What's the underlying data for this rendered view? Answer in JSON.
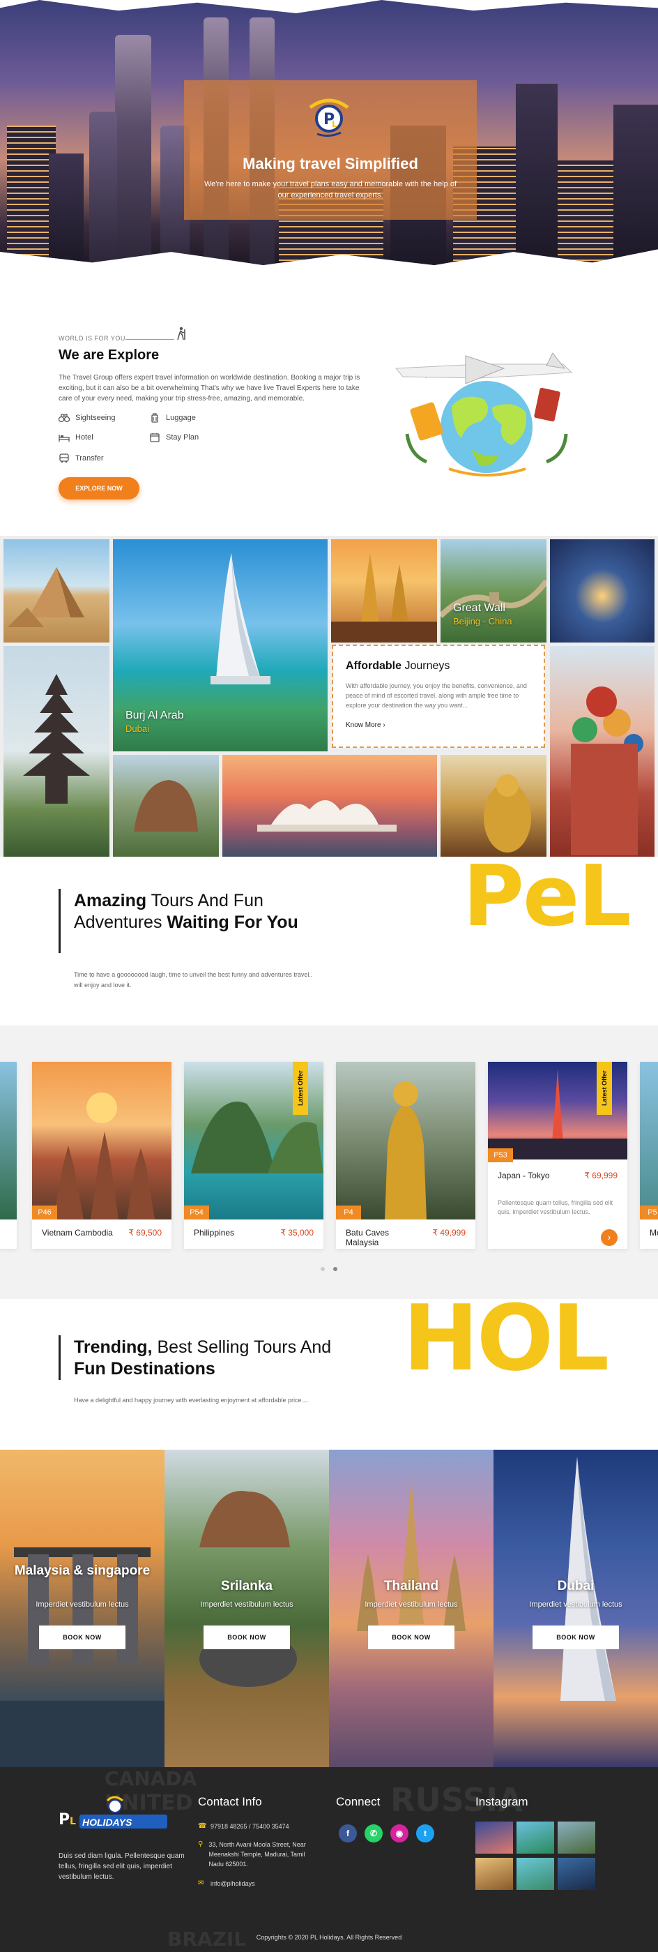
{
  "hero": {
    "title": "Making travel Simplified",
    "subtitle": "We're here to make your travel plans easy and memorable with the help of our experienced travel experts.",
    "slides": 2,
    "active_slide": 1
  },
  "explore": {
    "kicker": "WORLD IS FOR YOU",
    "title": "We are Explore",
    "text": "The Travel Group offers expert travel information on worldwide destination. Booking a major trip is exciting, but it can also be a bit overwhelming That's why we have live Travel Experts here to take care of your every need, making your trip stress-free, amazing, and memorable.",
    "features": [
      "Sightseeing",
      "Luggage",
      "Hotel",
      "Stay Plan",
      "Transfer"
    ],
    "button": "EXPLORE NOW"
  },
  "gallery": {
    "burj_title": "Burj Al Arab",
    "burj_sub": "Dubai",
    "wall_title": "Great Wall",
    "wall_sub": "Beijing - China",
    "aff_title_bold": "Affordable",
    "aff_title_rest": " Journeys",
    "aff_text": "With affordable journey, you enjoy the benefits, convenience, and peace of mind of escorted travel, along with ample free time to explore your destination the way you want...",
    "aff_link": "Know More"
  },
  "amazing": {
    "watermark": "PeL",
    "title_bold1": "Amazing",
    "title_rest1": " Tours And Fun Adventures ",
    "title_bold2": "Waiting For You",
    "text": "Time to have a goooooood laugh, time to unveil the best funny and adventures travel.. will enjoy and love it."
  },
  "tours": {
    "cards": [
      {
        "code": "P46",
        "name": "Vietnam Cambodia",
        "price": "₹ 69,500"
      },
      {
        "code": "P54",
        "name": "Philippines",
        "price": "₹ 35,000",
        "ribbon": "Latest Offer"
      },
      {
        "code": "P4",
        "name": "Batu Caves Malaysia",
        "price": "₹ 49,999"
      },
      {
        "code": "P53",
        "name": "Japan - Tokyo",
        "price": "₹ 69,999",
        "ribbon": "Latest Offer",
        "desc": "Pellentesque quam tellus, fringilla sed elit quis, imperdiet vestibulum lectus."
      }
    ],
    "edge_left_price": "000",
    "edge_right_code": "P5",
    "edge_right_name": "Mo"
  },
  "trending": {
    "watermark": "HOL",
    "title_bold1": "Trending,",
    "title_rest1": " Best Selling Tours And ",
    "title_bold2": "Fun Destinations",
    "text": "Have a delightful and happy journey with everlasting enjoyment at affordable price...."
  },
  "destinations": [
    {
      "name": "Malaysia & singapore",
      "sub": "Imperdiet vestibulum lectus",
      "button": "BOOK NOW"
    },
    {
      "name": "Srilanka",
      "sub": "Imperdiet vestibulum lectus",
      "button": "BOOK NOW"
    },
    {
      "name": "Thailand",
      "sub": "Imperdiet vestibulum lectus",
      "button": "BOOK NOW"
    },
    {
      "name": "Dubai",
      "sub": "Imperdiet vestibulum lectus",
      "button": "BOOK NOW"
    }
  ],
  "footer": {
    "logo_text": "HOLIDAYS",
    "about": "Duis sed diam ligula. Pellentesque quam tellus, fringilla sed elit quis, imperdiet vestibulum lectus.",
    "contact_title": "Contact Info",
    "phone": "97918 48265 / 75400 35474",
    "address": "33, North Avani Moola Street, Near Meenakshi Temple, Madurai, Tamil Nadu 625001.",
    "email": "info@plholidays",
    "connect_title": "Connect",
    "instagram_title": "Instagram",
    "copyright": "Copyrights © 2020 PL Holidays. All Rights Reserved",
    "map_words": [
      "CANADA",
      "UNITED",
      "RUSSIA",
      "BRAZIL"
    ]
  }
}
